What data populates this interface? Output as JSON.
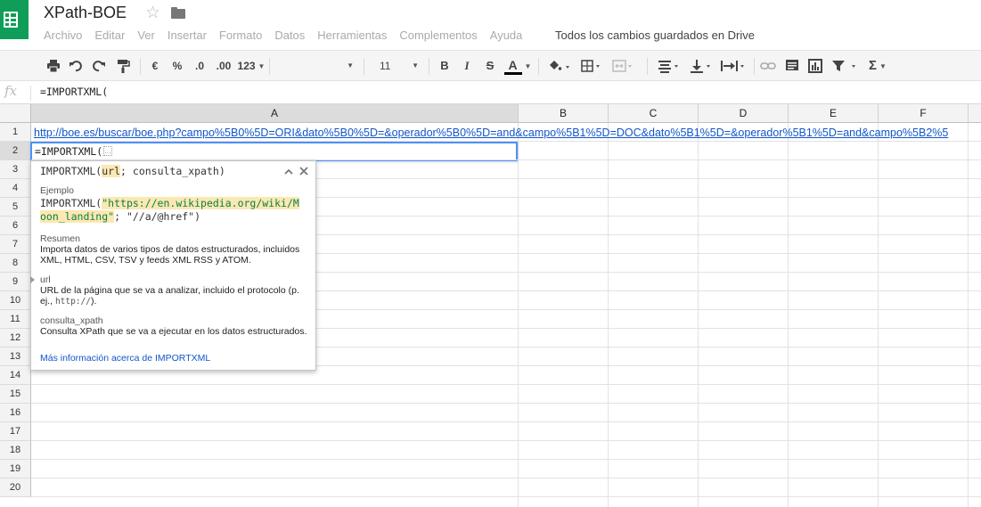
{
  "app": {
    "title": "XPath-BOE",
    "logo_icon": "sheets-grid-icon",
    "star_icon": "star-outline-icon",
    "folder_icon": "folder-icon",
    "save_status": "Todos los cambios guardados en Drive"
  },
  "menubar": [
    "Archivo",
    "Editar",
    "Ver",
    "Insertar",
    "Formato",
    "Datos",
    "Herramientas",
    "Complementos",
    "Ayuda"
  ],
  "toolbar": {
    "print_icon": "print-icon",
    "undo_icon": "undo-icon",
    "redo_icon": "redo-icon",
    "paint_format_icon": "paint-format-icon",
    "currency_label": "€",
    "percent_label": "%",
    "decimal_decrease_label": ".0",
    "decimal_increase_label": ".00",
    "more_formats_label": "123",
    "font_family_value": "",
    "font_size_value": "11",
    "bold_label": "B",
    "italic_label": "I",
    "strikethrough_label": "S",
    "text_color_label": "A",
    "text_color": "#000000",
    "icons": [
      "fill-color-icon",
      "borders-icon",
      "merge-cells-icon",
      "horizontal-align-icon",
      "vertical-align-icon",
      "text-wrap-icon",
      "link-icon",
      "comment-icon",
      "chart-icon",
      "filter-icon",
      "functions-icon"
    ],
    "functions_label": "Σ"
  },
  "formula_bar": {
    "fx_label": "fx",
    "value": "=IMPORTXML("
  },
  "grid": {
    "columns": [
      "A",
      "B",
      "C",
      "D",
      "E",
      "F"
    ],
    "active_column": "A",
    "rows": [
      "1",
      "2",
      "3",
      "4",
      "5",
      "6",
      "7",
      "8",
      "9",
      "10",
      "11",
      "12",
      "13",
      "14",
      "15",
      "16",
      "17",
      "18",
      "19",
      "20"
    ],
    "active_row": "2",
    "cell_a1": "http://boe.es/buscar/boe.php?campo%5B0%5D=ORI&dato%5B0%5D=&operador%5B0%5D=and&campo%5B1%5D=DOC&dato%5B1%5D=&operador%5B1%5D=and&campo%5B2%5",
    "cell_a2": "=IMPORTXML(",
    "cell_a2_hint": "..."
  },
  "formula_help": {
    "function_name": "IMPORTXML(",
    "arg1": "url",
    "separator": "; ",
    "arg2": "consulta_xpath",
    "close_paren": ")",
    "example_title": "Ejemplo",
    "example_fn": "IMPORTXML(",
    "example_str_line1": "\"https://en.wikipedia.org/wiki/M",
    "example_str_line2": "oon_landing\"",
    "example_rest": "; \"//a/@href\")",
    "summary_title": "Resumen",
    "summary_text": "Importa datos de varios tipos de datos estructurados, incluidos XML, HTML, CSV, TSV y feeds XML RSS y ATOM.",
    "arg1_title": "url",
    "arg1_text_a": "URL de la página que se va a analizar, incluido el protocolo (p. ej.,",
    "arg1_code": "http://",
    "arg1_text_b": ").",
    "arg2_title": "consulta_xpath",
    "arg2_text": "Consulta XPath que se va a ejecutar en los datos estructurados.",
    "more_info_link": "Más información acerca de IMPORTXML",
    "collapse_icon": "chevron-up-icon",
    "close_icon": "close-icon"
  }
}
